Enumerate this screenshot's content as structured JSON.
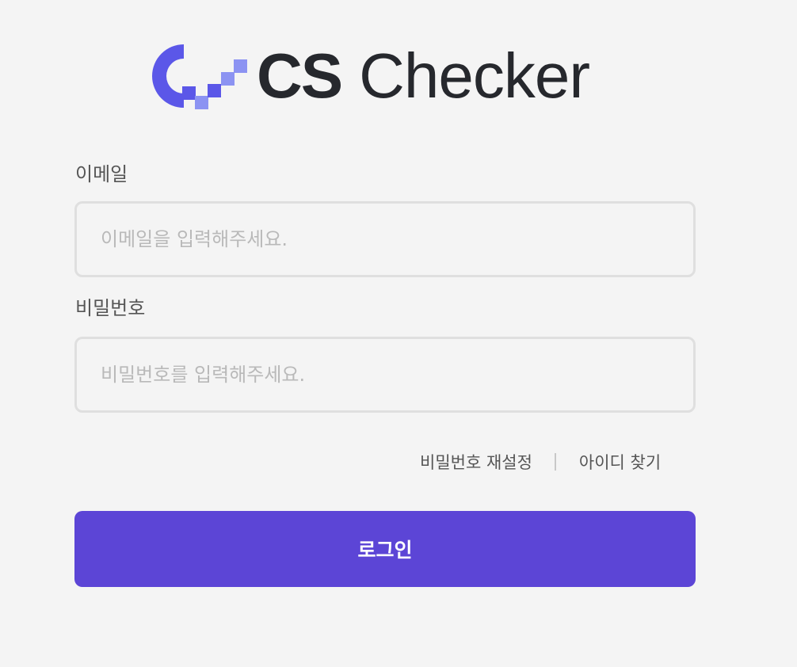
{
  "brand": {
    "logo_primary": "CS",
    "logo_secondary": "Checker",
    "accent_color": "#5c45d6",
    "logo_mark_color": "#5b57e8",
    "logo_pixel_color": "#8c93f2"
  },
  "form": {
    "email": {
      "label": "이메일",
      "placeholder": "이메일을 입력해주세요."
    },
    "password": {
      "label": "비밀번호",
      "placeholder": "비밀번호를 입력해주세요."
    }
  },
  "links": {
    "reset_password": "비밀번호 재설정",
    "divider": "|",
    "find_id": "아이디 찾기"
  },
  "actions": {
    "login": "로그인"
  }
}
